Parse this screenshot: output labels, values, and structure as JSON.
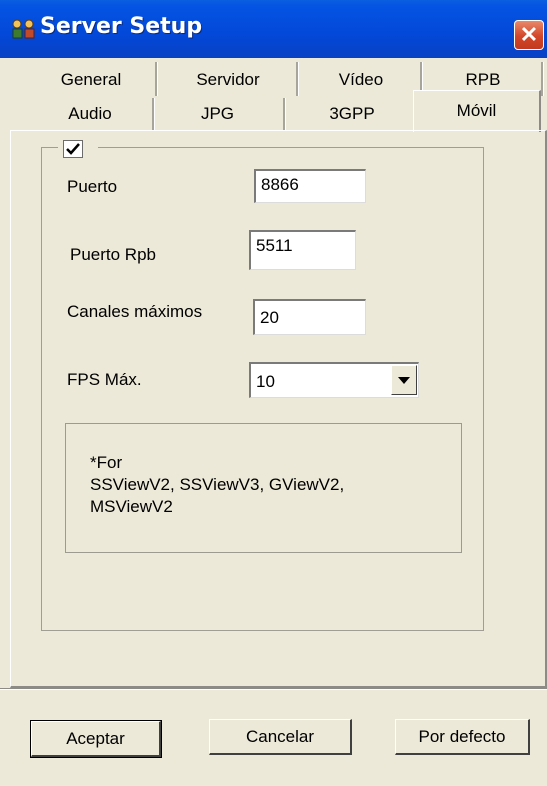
{
  "window": {
    "title": "Server Setup",
    "close_glyph": "✕"
  },
  "tabs_row1": [
    "General",
    "Servidor",
    "Vídeo",
    "RPB"
  ],
  "tabs_row2": [
    "Audio",
    "JPG",
    "3GPP",
    "Móvil"
  ],
  "active_tab": "Móvil",
  "mobile": {
    "enabled_checked": true,
    "puerto_label": "Puerto",
    "puerto_value": "8866",
    "puerto_rpb_label": "Puerto Rpb",
    "puerto_rpb_value": "5511",
    "canales_label": "Canales máximos",
    "canales_value": "20",
    "fps_label": "FPS Máx.",
    "fps_value": "10",
    "note": "*For\nSSViewV2, SSViewV3, GViewV2,\nMSViewV2"
  },
  "buttons": {
    "ok": "Aceptar",
    "cancel": "Cancelar",
    "defaults": "Por defecto"
  },
  "colors": {
    "titlebar": "#0554e3",
    "close": "#d3462a",
    "face": "#ece9d8"
  }
}
